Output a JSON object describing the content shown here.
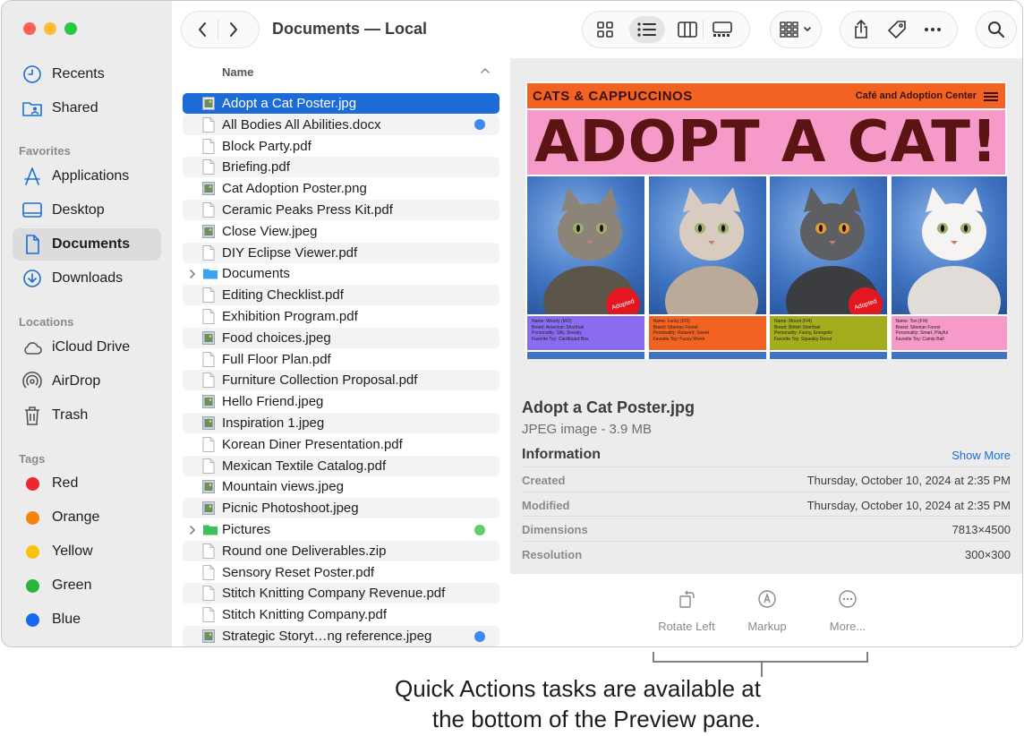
{
  "window": {
    "title": "Documents — Local"
  },
  "sidebar": {
    "sections": {
      "favorites": "Favorites",
      "locations": "Locations",
      "tags": "Tags"
    },
    "top": [
      {
        "label": "Recents",
        "icon": "clock-icon"
      },
      {
        "label": "Shared",
        "icon": "shared-folder-icon"
      }
    ],
    "favorites": [
      {
        "label": "Applications",
        "icon": "applications-icon"
      },
      {
        "label": "Desktop",
        "icon": "desktop-icon"
      },
      {
        "label": "Documents",
        "icon": "document-icon",
        "selected": true
      },
      {
        "label": "Downloads",
        "icon": "download-icon"
      }
    ],
    "locations": [
      {
        "label": "iCloud Drive",
        "icon": "cloud-icon"
      },
      {
        "label": "AirDrop",
        "icon": "airdrop-icon"
      },
      {
        "label": "Trash",
        "icon": "trash-icon"
      }
    ],
    "tags": [
      {
        "label": "Red",
        "color": "#f0262d"
      },
      {
        "label": "Orange",
        "color": "#f8830c"
      },
      {
        "label": "Yellow",
        "color": "#f9c20d"
      },
      {
        "label": "Green",
        "color": "#28b53a"
      },
      {
        "label": "Blue",
        "color": "#1769ef"
      }
    ]
  },
  "list": {
    "column": "Name",
    "rows": [
      {
        "name": "Adopt a Cat Poster.jpg",
        "kind": "image",
        "selected": true
      },
      {
        "name": "All Bodies All Abilities.docx",
        "kind": "doc",
        "tag": "#3b8bf0"
      },
      {
        "name": "Block Party.pdf",
        "kind": "doc"
      },
      {
        "name": "Briefing.pdf",
        "kind": "doc"
      },
      {
        "name": "Cat Adoption Poster.png",
        "kind": "image"
      },
      {
        "name": "Ceramic Peaks Press Kit.pdf",
        "kind": "doc"
      },
      {
        "name": "Close View.jpeg",
        "kind": "image"
      },
      {
        "name": "DIY Eclipse Viewer.pdf",
        "kind": "doc"
      },
      {
        "name": "Documents",
        "kind": "folder",
        "folderColor": "#3aa4f0"
      },
      {
        "name": "Editing Checklist.pdf",
        "kind": "doc"
      },
      {
        "name": "Exhibition Program.pdf",
        "kind": "doc"
      },
      {
        "name": "Food choices.jpeg",
        "kind": "image"
      },
      {
        "name": "Full Floor Plan.pdf",
        "kind": "doc"
      },
      {
        "name": "Furniture Collection Proposal.pdf",
        "kind": "doc"
      },
      {
        "name": "Hello Friend.jpeg",
        "kind": "image"
      },
      {
        "name": "Inspiration 1.jpeg",
        "kind": "image"
      },
      {
        "name": "Korean Diner Presentation.pdf",
        "kind": "doc"
      },
      {
        "name": "Mexican Textile Catalog.pdf",
        "kind": "doc"
      },
      {
        "name": "Mountain views.jpeg",
        "kind": "image"
      },
      {
        "name": "Picnic Photoshoot.jpeg",
        "kind": "image"
      },
      {
        "name": "Pictures",
        "kind": "folder",
        "folderColor": "#38c05a",
        "tag": "#5fcf6a"
      },
      {
        "name": "Round one Deliverables.zip",
        "kind": "doc"
      },
      {
        "name": "Sensory Reset Poster.pdf",
        "kind": "doc"
      },
      {
        "name": "Stitch Knitting Company Revenue.pdf",
        "kind": "doc"
      },
      {
        "name": "Stitch Knitting Company.pdf",
        "kind": "doc"
      },
      {
        "name": "Strategic Storyt…ng reference.jpeg",
        "kind": "image",
        "tag": "#3b8bf0"
      }
    ]
  },
  "poster": {
    "brand": "CATS & CAPPUCCINOS",
    "tagline": "Café and Adoption Center",
    "headline": "ADOPT A CAT!",
    "stamp": "Adopted",
    "cats": [
      {
        "name": "Name: Woody (M/2)",
        "breed": "Breed: American Shorthair",
        "personality": "Personality: Silly, Sneaky",
        "toy": "Favorite Toy: Cardboard Box",
        "card": "#8a6cf0",
        "adopted": true
      },
      {
        "name": "Name: Lucky (F/3)",
        "breed": "Breed: Siberian Forest",
        "personality": "Personality: Relaxed, Sweet",
        "toy": "Favorite Toy: Fuzzy Worm",
        "card": "#f26322",
        "adopted": false
      },
      {
        "name": "Name: Mount (F/4)",
        "breed": "Breed: British Shorthair",
        "personality": "Personality: Funny, Energetic",
        "toy": "Favorite Toy: Squeaky Donut",
        "card": "#a3ad1d",
        "adopted": true
      },
      {
        "name": "Name: Tori (F/4)",
        "breed": "Breed: Siberian Forest",
        "personality": "Personality: Smart, Playful",
        "toy": "Favorite Toy: Catnip Ball",
        "card": "#f59ac9",
        "adopted": false
      }
    ]
  },
  "preview": {
    "filename": "Adopt a Cat Poster.jpg",
    "kind": "JPEG image - 3.9 MB",
    "info_heading": "Information",
    "show_more": "Show More",
    "rows": [
      {
        "k": "Created",
        "v": "Thursday, October 10, 2024 at 2:35 PM"
      },
      {
        "k": "Modified",
        "v": "Thursday, October 10, 2024 at 2:35 PM"
      },
      {
        "k": "Dimensions",
        "v": "7813×4500"
      },
      {
        "k": "Resolution",
        "v": "300×300"
      }
    ]
  },
  "quick_actions": {
    "rotate": "Rotate Left",
    "markup": "Markup",
    "more": "More..."
  },
  "caption": {
    "line1": "Quick Actions tasks are available at",
    "line2": "the bottom of the Preview pane."
  },
  "traffic": {
    "close": "#fe5f57",
    "minimize": "#febc2e",
    "zoom": "#28c840"
  }
}
